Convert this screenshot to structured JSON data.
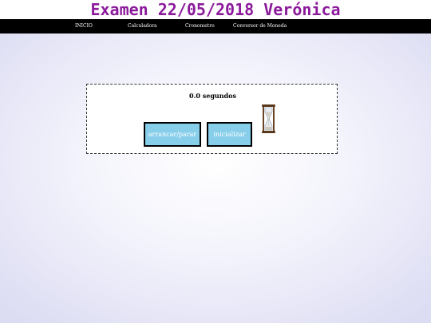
{
  "page": {
    "title": "Examen 22/05/2018 Verónica"
  },
  "nav": {
    "items": [
      {
        "label": "INICIO"
      },
      {
        "label": "Calculadora"
      },
      {
        "label": "Cronometro"
      },
      {
        "label": "Conversor de Moneda"
      }
    ]
  },
  "stopwatch": {
    "display": "0.0 segundos",
    "start_stop_label": "arrancar/parar",
    "reset_label": "inicializar",
    "icon": "hourglass-icon"
  },
  "colors": {
    "title": "#8b1a9b",
    "navbar": "#000000",
    "button_bg": "#87ceeb",
    "button_text": "#ffffff"
  }
}
